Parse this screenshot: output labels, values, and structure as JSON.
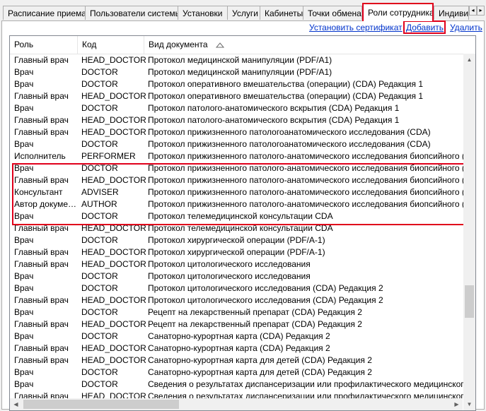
{
  "tabs": [
    {
      "label": "Расписание приема"
    },
    {
      "label": "Пользователи системы"
    },
    {
      "label": "Установки"
    },
    {
      "label": "Услуги"
    },
    {
      "label": "Кабинеты"
    },
    {
      "label": "Точки обмена"
    },
    {
      "label": "Роли сотрудника",
      "active": true
    },
    {
      "label": "Индивид"
    }
  ],
  "tab_scroll": {
    "left": "◂",
    "right": "▸"
  },
  "toolbar": {
    "set_certificate": "Установить сертификат",
    "add": "Добавить",
    "delete": "Удалить"
  },
  "grid": {
    "columns": [
      "Роль",
      "Код",
      "Вид документа"
    ],
    "sort_column": "Вид документа",
    "sort_direction": "ascending",
    "rows": [
      {
        "role": "Главный врач",
        "code": "HEAD_DOCTOR",
        "doc": "Протокол медицинской манипуляции (PDF/A1)"
      },
      {
        "role": "Врач",
        "code": "DOCTOR",
        "doc": "Протокол медицинской манипуляции (PDF/A1)"
      },
      {
        "role": "Врач",
        "code": "DOCTOR",
        "doc": "Протокол оперативного вмешательства (операции) (CDA) Редакция 1"
      },
      {
        "role": "Главный врач",
        "code": "HEAD_DOCTOR",
        "doc": "Протокол оперативного вмешательства (операции) (CDA) Редакция 1"
      },
      {
        "role": "Врач",
        "code": "DOCTOR",
        "doc": "Протокол патолого-анатомического вскрытия (CDA) Редакция 1"
      },
      {
        "role": "Главный врач",
        "code": "HEAD_DOCTOR",
        "doc": "Протокол патолого-анатомического вскрытия (CDA) Редакция 1"
      },
      {
        "role": "Главный врач",
        "code": "HEAD_DOCTOR",
        "doc": "Протокол прижизненного патологоанатомического исследования (CDA)"
      },
      {
        "role": "Врач",
        "code": "DOCTOR",
        "doc": "Протокол прижизненного патологоанатомического исследования (CDA)"
      },
      {
        "role": "Исполнитель",
        "code": "PERFORMER",
        "doc": "Протокол прижизненного патолого-анатомического исследования биопсийного (операцио"
      },
      {
        "role": "Врач",
        "code": "DOCTOR",
        "doc": "Протокол прижизненного патолого-анатомического исследования биопсийного (операцио"
      },
      {
        "role": "Главный врач",
        "code": "HEAD_DOCTOR",
        "doc": "Протокол прижизненного патолого-анатомического исследования биопсийного (операцио"
      },
      {
        "role": "Консультант",
        "code": "ADVISER",
        "doc": "Протокол прижизненного патолого-анатомического исследования биопсийного (операцио"
      },
      {
        "role": "Автор докумен...",
        "code": "AUTHOR",
        "doc": "Протокол прижизненного патолого-анатомического исследования биопсийного (операцио"
      },
      {
        "role": "Врач",
        "code": "DOCTOR",
        "doc": "Протокол телемедицинской консультации CDA"
      },
      {
        "role": "Главный врач",
        "code": "HEAD_DOCTOR",
        "doc": "Протокол телемедицинской консультации CDA"
      },
      {
        "role": "Врач",
        "code": "DOCTOR",
        "doc": "Протокол хирургической операции (PDF/A-1)"
      },
      {
        "role": "Главный врач",
        "code": "HEAD_DOCTOR",
        "doc": "Протокол хирургической операции (PDF/A-1)"
      },
      {
        "role": "Главный врач",
        "code": "HEAD_DOCTOR",
        "doc": "Протокол цитологического исследования"
      },
      {
        "role": "Врач",
        "code": "DOCTOR",
        "doc": "Протокол цитологического исследования"
      },
      {
        "role": "Врач",
        "code": "DOCTOR",
        "doc": "Протокол цитологического исследования (CDA) Редакция 2"
      },
      {
        "role": "Главный врач",
        "code": "HEAD_DOCTOR",
        "doc": "Протокол цитологического исследования (CDA) Редакция 2"
      },
      {
        "role": "Врач",
        "code": "DOCTOR",
        "doc": "Рецепт на лекарственный препарат (CDA) Редакция 2"
      },
      {
        "role": "Главный врач",
        "code": "HEAD_DOCTOR",
        "doc": "Рецепт на лекарственный препарат (CDA) Редакция 2"
      },
      {
        "role": "Врач",
        "code": "DOCTOR",
        "doc": "Санаторно-курортная карта (CDA) Редакция 2"
      },
      {
        "role": "Главный врач",
        "code": "HEAD_DOCTOR",
        "doc": "Санаторно-курортная карта (CDA) Редакция 2"
      },
      {
        "role": "Главный врач",
        "code": "HEAD_DOCTOR",
        "doc": "Санаторно-курортная карта для детей (CDA) Редакция 2"
      },
      {
        "role": "Врач",
        "code": "DOCTOR",
        "doc": "Санаторно-курортная карта для детей (CDA) Редакция 2"
      },
      {
        "role": "Врач",
        "code": "DOCTOR",
        "doc": "Сведения о результатах диспансеризации или профилактического медицинского осмотра"
      },
      {
        "role": "Главный врач",
        "code": "HEAD_DOCTOR",
        "doc": "Сведения о результатах диспансеризации или профилактического медицинского осмотра"
      }
    ]
  },
  "colors": {
    "highlight": "#e0001b",
    "link": "#0033cc",
    "grid_line": "#e5e5e5"
  }
}
